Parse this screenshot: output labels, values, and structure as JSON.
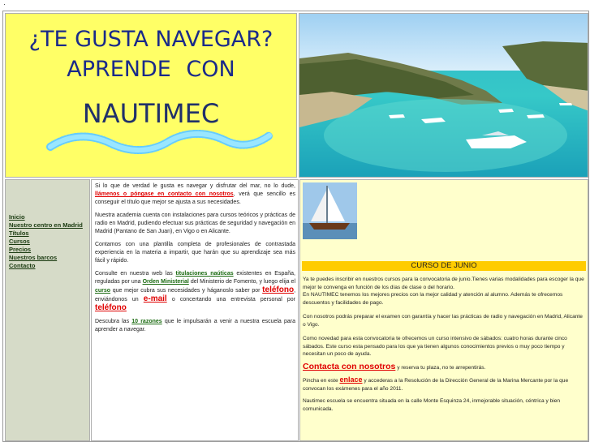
{
  "banner": {
    "line1": "¿TE GUSTA NAVEGAR?",
    "line2": "APRENDE    CON",
    "brand": "NAUTIMEC"
  },
  "nav": {
    "items": [
      {
        "label": "Inicio"
      },
      {
        "label": "Nuestro centro en Madrid"
      },
      {
        "label": "Títulos"
      },
      {
        "label": "Cursos"
      },
      {
        "label": "Precios"
      },
      {
        "label": "Nuestros barcos"
      },
      {
        "label": "Contacto"
      }
    ]
  },
  "mid": {
    "p1_a": "Si lo que de verdad le gusta es navegar y disfrutar del mar, no lo dude,",
    "p1_link": "llámenos o póngase en contacto con nosotros",
    "p1_b": ", verá que sencillo es conseguir el título que mejor se ajusta a sus necesidades.",
    "p2": "Nuestra academia cuenta con instalaciones para cursos teóricos y prácticas de radio en Madrid, pudiendo efectuar sus prácticas de seguridad y navegación en Madrid (Pantano de San Juan), en Vigo o en Alicante.",
    "p3": "Contamos con una plantilla completa de profesionales de contrastada experiencia en la materia a impartir, que harán que su aprendizaje sea más fácil y rápido.",
    "p4_a": "Consulte en nuestra web las",
    "p4_link1": "titulaciones naúticas",
    "p4_b": "existentes en España, reguladas por una",
    "p4_link2": "Orden Ministerial",
    "p4_c": "del Ministerio de Fomento, y luego elija el",
    "p4_link3": "curso",
    "p4_d": "que mejor cubra sus necesidades y háganoslo saber por",
    "p4_link4": "teléfono",
    "p4_e": ", enviándonos un",
    "p4_link5": "e-mail",
    "p4_f": "o concertando una entrevista personal por",
    "p4_link6": "teléfono",
    "p5_a": "Descubra las",
    "p5_link": "10 razones",
    "p5_b": "que le impulsarán a venir a nuestra escuela para aprender a navegar."
  },
  "right": {
    "curso_title": "CURSO DE JUNIO",
    "r1": "Ya te puedes inscribir en nuestros cursos para la convocatoria de junio.Tienes varias modalidades  para escoger la que mejor te convenga en función de los días de clase o del horario.",
    "r2": "En NAUTIMEC tenemos los mejores precios con la mejor calidad y atención al alumno. Además te ofrecemos descuentos y facilidades de pago.",
    "r3": "Con nosotros podrás preparar el examen con garantía y  hacer las prácticas de radio y navegación en Madrid, Alicante o Vigo.",
    "r4": "Como novedad para esta convocatoria te ofrecemos un curso intensivo de sábados: cuatro horas durante cinco sábados.  Este curso esta pensado para los que ya tienen algunos  conocimientos previos o muy poco tiempo y necesitan un poco de ayuda.",
    "r5_link": "Contacta con nosotros",
    "r5_b": "y reserva tu plaza, no te arrepentirás.",
    "r6_a": "Pincha en este",
    "r6_link": "enlace",
    "r6_b": "y accederas a la Resolución de la Dirección General de la Marina Mercante por la que convocan los exámenes para el año 2011.",
    "r7": "Nautimec escuela se encuentra situada en la calle Monte Esquinza 24, inmejorable situación, céntrica y bien comunicada."
  },
  "colors": {
    "banner_bg": "#ffff66",
    "headline": "#1a2a8a",
    "nav_bg": "#d6dbc8",
    "right_bg": "#ffffcc",
    "accent_red": "#e00000",
    "curso_bar": "#ffcc00"
  }
}
